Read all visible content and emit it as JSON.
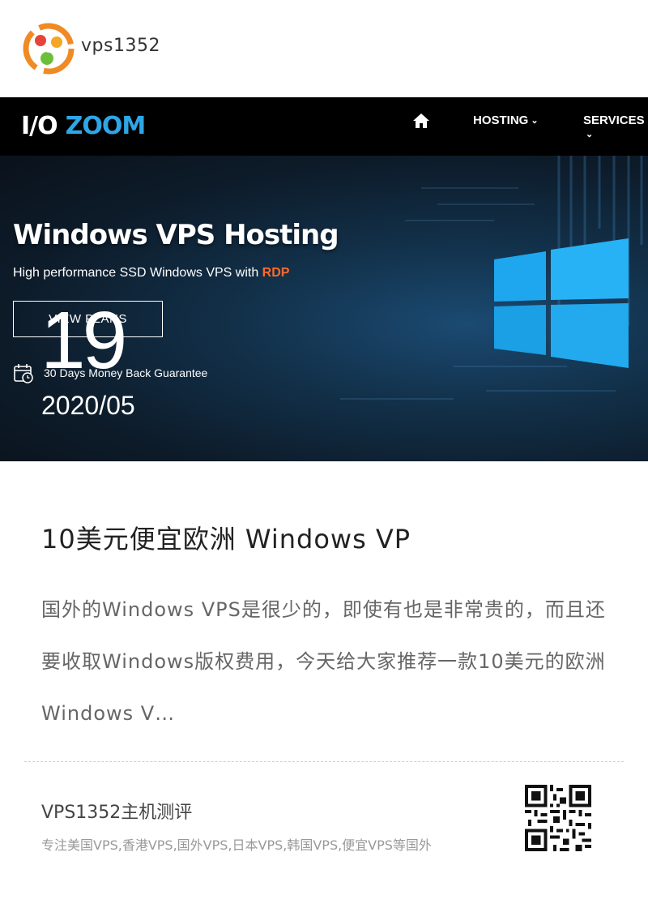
{
  "site": {
    "name": "vps1352",
    "logo_icon": "vps1352-logo-icon"
  },
  "cover": {
    "brand": {
      "io": "I/O",
      "zoom": "ZOOM"
    },
    "nav": {
      "home_icon": "home-icon",
      "hosting": "HOSTING",
      "services": "SERVICES"
    },
    "hero_title": "Windows VPS Hosting",
    "hero_subtitle_prefix": "High performance SSD Windows VPS with ",
    "hero_subtitle_highlight": "RDP",
    "button_label": "VIEW PLANS",
    "guarantee": "30 Days Money Back Guarantee",
    "accent_color": "#ff6a2a",
    "brand_color": "#2ea6e6"
  },
  "date": {
    "day": "19",
    "year_month": "2020/05"
  },
  "article": {
    "title": "10美元便宜欧洲 Windows VP",
    "excerpt": "国外的Windows VPS是很少的，即使有也是非常贵的，而且还要收取Windows版权费用，今天给大家推荐一款10美元的欧洲Windows V…"
  },
  "footer": {
    "title": "VPS1352主机测评",
    "description": "专注美国VPS,香港VPS,国外VPS,日本VPS,韩国VPS,便宜VPS等国外",
    "qr_icon": "qr-code-icon"
  }
}
